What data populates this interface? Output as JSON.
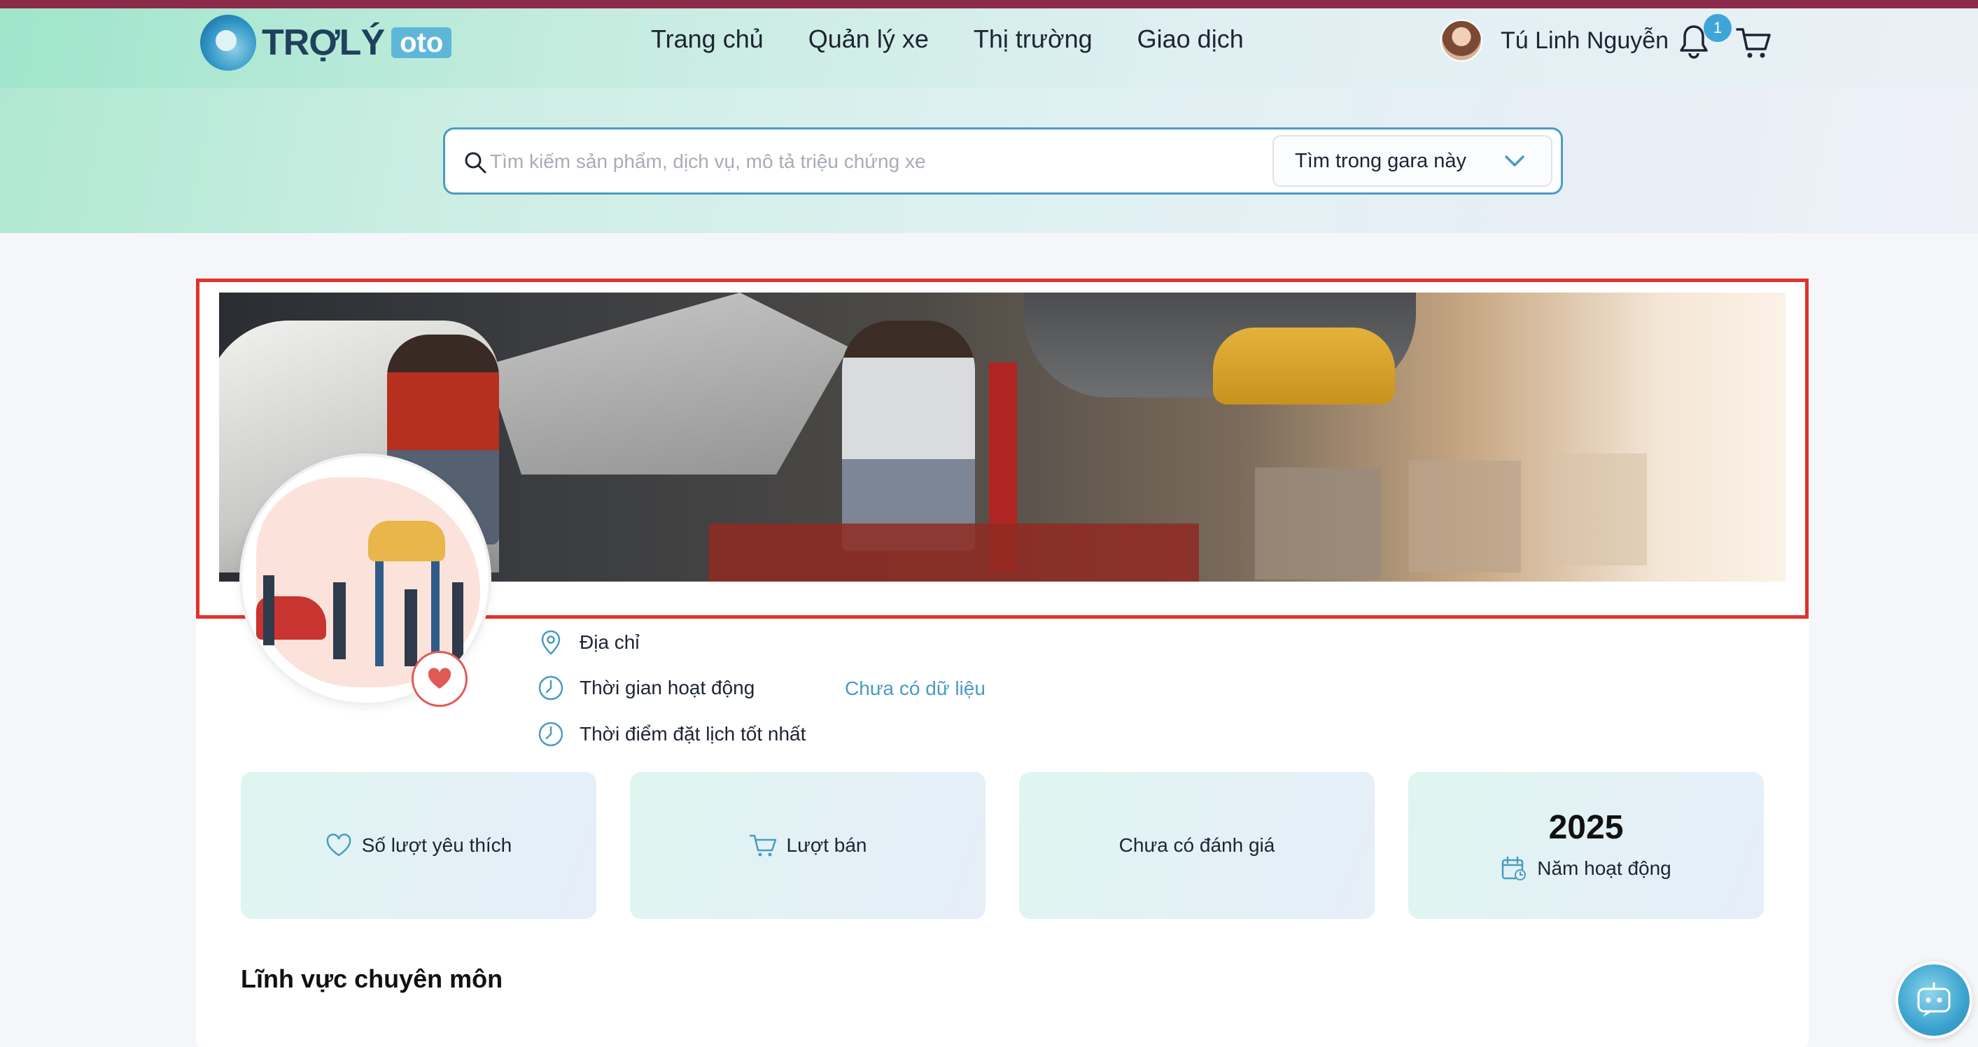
{
  "brand": {
    "name": "TRỢLÝ",
    "suffix": "oto"
  },
  "nav": {
    "items": [
      {
        "label": "Trang chủ"
      },
      {
        "label": "Quản lý xe"
      },
      {
        "label": "Thị trường"
      },
      {
        "label": "Giao dịch"
      }
    ]
  },
  "user": {
    "name": "Tú Linh Nguyễn",
    "notification_count": "1"
  },
  "search": {
    "placeholder": "Tìm kiếm sản phẩm, dịch vụ, mô tả triệu chứng xe",
    "scope": "Tìm trong gara này"
  },
  "garage": {
    "info": {
      "address_label": "Địa chỉ",
      "hours_label": "Thời gian hoạt động",
      "hours_value": "Chưa có dữ liệu",
      "best_time_label": "Thời điểm đặt lịch tốt nhất"
    },
    "stats": {
      "likes_label": "Số lượt yêu thích",
      "sales_label": "Lượt bán",
      "rating_label": "Chưa có đánh giá",
      "year_value": "2025",
      "year_label": "Năm hoạt động"
    },
    "section_title": "Lĩnh vực chuyên môn"
  },
  "colors": {
    "accent": "#4a9bc2",
    "top_strip": "#8c2a4a",
    "highlight_border": "#e0332c",
    "favorite": "#e05a55"
  },
  "icons": {
    "logo": "logo-mark-icon",
    "bell": "bell-icon",
    "cart": "cart-icon",
    "search": "search-icon",
    "chevron": "chevron-down-icon",
    "location": "location-pin-icon",
    "clock": "clock-icon",
    "heart": "heart-icon",
    "calendar": "calendar-icon",
    "chatbot": "chatbot-icon"
  }
}
